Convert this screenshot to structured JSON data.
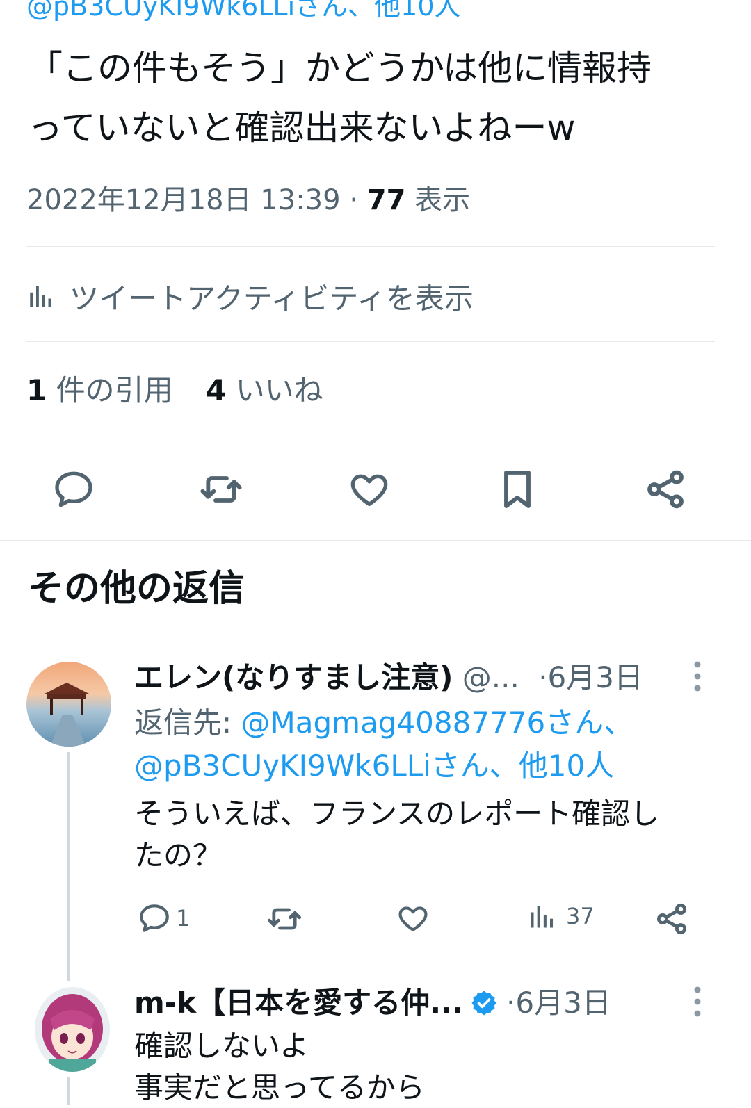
{
  "tweet": {
    "reply_to_top": "@pB3CUyKI9Wk6LLiさん、他10人",
    "text_line1": "「この件もそう」かどうかは他に情報持",
    "text_line2": "っていないと確認出来ないよねーw",
    "timestamp": "2022年12月18日 13:39",
    "separator": "·",
    "views_count": "77",
    "views_label": "表示",
    "activity_label": "ツイートアクティビティを表示",
    "quotes_count": "1",
    "quotes_label": "件の引用",
    "likes_count": "4",
    "likes_label": "いいね"
  },
  "section_title": "その他の返信",
  "replies": [
    {
      "display_name": "エレン(なりすまし注意)",
      "handle": "@...",
      "date": "·6月3日",
      "reply_to_label": "返信先:",
      "reply_to_line1": "@Magmag40887776さん、",
      "reply_to_line2": "@pB3CUyKI9Wk6LLiさん、他10人",
      "text_line1": "そういえば、フランスのレポート確認し",
      "text_line2": "たの？",
      "reply_count": "1",
      "views_count": "37"
    },
    {
      "display_name": "m-k【日本を愛する仲...",
      "date": "·6月3日",
      "verified": true,
      "text_line1": "確認しないよ",
      "text_line2": "事実だと思ってるから"
    }
  ],
  "icons": [
    "reply-icon",
    "retweet-icon",
    "like-icon",
    "bookmark-icon",
    "share-icon",
    "analytics-icon",
    "more-icon",
    "verified-icon"
  ],
  "colors": {
    "accent": "#1d9bf0",
    "muted": "#536471",
    "text": "#0f1419",
    "divider": "#e6e9eb"
  }
}
